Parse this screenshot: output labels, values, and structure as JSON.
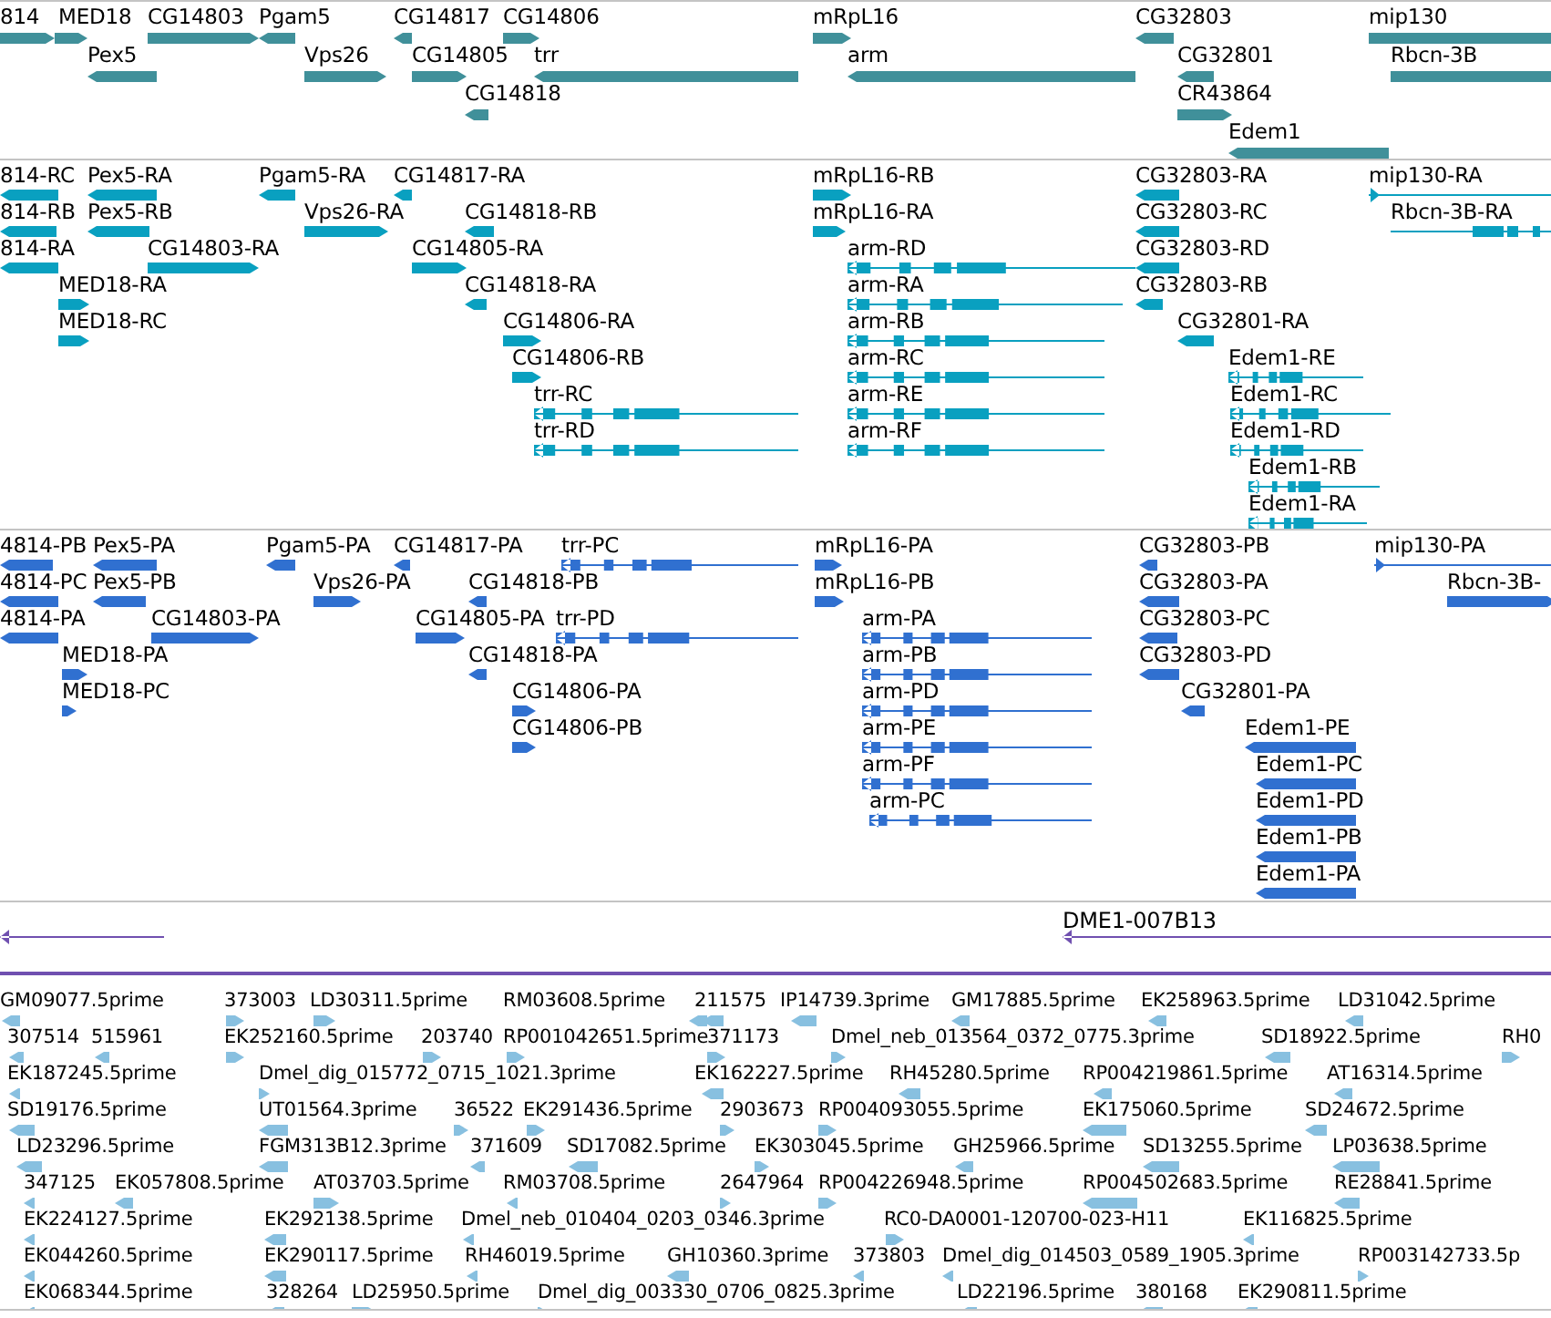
{
  "tracks": [
    {
      "kind": "gene",
      "features": [
        {
          "label": "814",
          "reverse": false
        },
        {
          "label": "MED18",
          "reverse": false
        },
        {
          "label": "CG14803",
          "reverse": false
        },
        {
          "label": "Pgam5",
          "reverse": true
        },
        {
          "label": "CG14817",
          "reverse": true
        },
        {
          "label": "CG14806",
          "reverse": false
        },
        {
          "label": "mRpL16",
          "reverse": false
        },
        {
          "label": "CG32803",
          "reverse": true
        },
        {
          "label": "mip130",
          "reverse": false
        },
        {
          "label": "Pex5",
          "reverse": true
        },
        {
          "label": "Vps26",
          "reverse": false
        },
        {
          "label": "CG14805",
          "reverse": false
        },
        {
          "label": "trr",
          "reverse": true
        },
        {
          "label": "arm",
          "reverse": true
        },
        {
          "label": "CG32801",
          "reverse": true
        },
        {
          "label": "Rbcn-3B",
          "reverse": false
        },
        {
          "label": "CG14818",
          "reverse": true
        },
        {
          "label": "CR43864",
          "reverse": false
        },
        {
          "label": "Edem1",
          "reverse": true
        }
      ]
    },
    {
      "kind": "transcript",
      "features": [
        {
          "label": "814-RC",
          "reverse": true
        },
        {
          "label": "Pex5-RA",
          "reverse": true
        },
        {
          "label": "Pgam5-RA",
          "reverse": true
        },
        {
          "label": "CG14817-RA",
          "reverse": true
        },
        {
          "label": "mRpL16-RB",
          "reverse": false
        },
        {
          "label": "CG32803-RA",
          "reverse": true
        },
        {
          "label": "mip130-RA",
          "reverse": false,
          "kind": "line"
        },
        {
          "label": "814-RB",
          "reverse": true
        },
        {
          "label": "Pex5-RB",
          "reverse": true
        },
        {
          "label": "Vps26-RA",
          "reverse": false
        },
        {
          "label": "CG14818-RB",
          "reverse": true
        },
        {
          "label": "mRpL16-RA",
          "reverse": false
        },
        {
          "label": "CG32803-RC",
          "reverse": true
        },
        {
          "label": "Rbcn-3B-RA",
          "reverse": false,
          "kind": "spliced"
        },
        {
          "label": "814-RA",
          "reverse": true
        },
        {
          "label": "CG14803-RA",
          "reverse": false
        },
        {
          "label": "CG14805-RA",
          "reverse": false
        },
        {
          "label": "arm-RD",
          "reverse": true,
          "kind": "spliced"
        },
        {
          "label": "CG32803-RD",
          "reverse": true
        },
        {
          "label": "MED18-RA",
          "reverse": false
        },
        {
          "label": "CG14818-RA",
          "reverse": true
        },
        {
          "label": "arm-RA",
          "reverse": true,
          "kind": "spliced"
        },
        {
          "label": "CG32803-RB",
          "reverse": true
        },
        {
          "label": "MED18-RC",
          "reverse": false
        },
        {
          "label": "CG14806-RA",
          "reverse": false
        },
        {
          "label": "arm-RB",
          "reverse": true,
          "kind": "spliced"
        },
        {
          "label": "CG32801-RA",
          "reverse": true
        },
        {
          "label": "CG14806-RB",
          "reverse": false
        },
        {
          "label": "arm-RC",
          "reverse": true,
          "kind": "spliced"
        },
        {
          "label": "Edem1-RE",
          "reverse": true,
          "kind": "spliced"
        },
        {
          "label": "trr-RC",
          "reverse": true,
          "kind": "spliced"
        },
        {
          "label": "arm-RE",
          "reverse": true,
          "kind": "spliced"
        },
        {
          "label": "Edem1-RC",
          "reverse": true,
          "kind": "spliced"
        },
        {
          "label": "trr-RD",
          "reverse": true,
          "kind": "spliced"
        },
        {
          "label": "arm-RF",
          "reverse": true,
          "kind": "spliced"
        },
        {
          "label": "Edem1-RD",
          "reverse": true,
          "kind": "spliced"
        },
        {
          "label": "Edem1-RB",
          "reverse": true,
          "kind": "spliced"
        },
        {
          "label": "Edem1-RA",
          "reverse": true,
          "kind": "spliced"
        }
      ]
    },
    {
      "kind": "protein",
      "features": [
        {
          "label": "4814-PB",
          "reverse": true
        },
        {
          "label": "Pex5-PA",
          "reverse": true
        },
        {
          "label": "Pgam5-PA",
          "reverse": true
        },
        {
          "label": "CG14817-PA",
          "reverse": true
        },
        {
          "label": "trr-PC",
          "reverse": true,
          "kind": "spliced"
        },
        {
          "label": "mRpL16-PA",
          "reverse": false
        },
        {
          "label": "CG32803-PB",
          "reverse": true
        },
        {
          "label": "mip130-PA",
          "reverse": false,
          "kind": "line"
        },
        {
          "label": "4814-PC",
          "reverse": true
        },
        {
          "label": "Pex5-PB",
          "reverse": true
        },
        {
          "label": "Vps26-PA",
          "reverse": false
        },
        {
          "label": "CG14818-PB",
          "reverse": true
        },
        {
          "label": "mRpL16-PB",
          "reverse": false
        },
        {
          "label": "CG32803-PA",
          "reverse": true
        },
        {
          "label": "Rbcn-3B-",
          "reverse": false
        },
        {
          "label": "4814-PA",
          "reverse": true
        },
        {
          "label": "CG14803-PA",
          "reverse": false
        },
        {
          "label": "CG14805-PA",
          "reverse": false
        },
        {
          "label": "trr-PD",
          "reverse": true,
          "kind": "spliced"
        },
        {
          "label": "arm-PA",
          "reverse": true,
          "kind": "spliced"
        },
        {
          "label": "CG32803-PC",
          "reverse": true
        },
        {
          "label": "MED18-PA",
          "reverse": false
        },
        {
          "label": "CG14818-PA",
          "reverse": true
        },
        {
          "label": "arm-PB",
          "reverse": true,
          "kind": "spliced"
        },
        {
          "label": "CG32803-PD",
          "reverse": true
        },
        {
          "label": "MED18-PC",
          "reverse": false
        },
        {
          "label": "CG14806-PA",
          "reverse": false
        },
        {
          "label": "arm-PD",
          "reverse": true,
          "kind": "spliced"
        },
        {
          "label": "CG32801-PA",
          "reverse": true
        },
        {
          "label": "CG14806-PB",
          "reverse": false
        },
        {
          "label": "arm-PE",
          "reverse": true,
          "kind": "spliced"
        },
        {
          "label": "Edem1-PE",
          "reverse": true
        },
        {
          "label": "arm-PF",
          "reverse": true,
          "kind": "spliced"
        },
        {
          "label": "Edem1-PC",
          "reverse": true
        },
        {
          "label": "arm-PC",
          "reverse": true,
          "kind": "spliced"
        },
        {
          "label": "Edem1-PD",
          "reverse": true
        },
        {
          "label": "Edem1-PB",
          "reverse": true
        },
        {
          "label": "Edem1-PA",
          "reverse": true
        }
      ]
    },
    {
      "kind": "clone",
      "features": [
        {
          "reverse": true,
          "kind": "line"
        },
        {
          "label": "DME1-007B13",
          "reverse": true,
          "kind": "line"
        }
      ]
    },
    {
      "kind": "est",
      "features": [
        {
          "label": "GM09077.5prime",
          "reverse": true
        },
        {
          "label": "373003",
          "reverse": false
        },
        {
          "label": "LD30311.5prime",
          "reverse": false
        },
        {
          "label": "RM03608.5prime",
          "reverse": true
        },
        {
          "label": "211575",
          "reverse": true
        },
        {
          "label": "IP14739.3prime",
          "reverse": true
        },
        {
          "label": "GM17885.5prime",
          "reverse": true
        },
        {
          "label": "EK258963.5prime",
          "reverse": true
        },
        {
          "label": "LD31042.5prime",
          "reverse": true
        },
        {
          "label": "307514",
          "reverse": true
        },
        {
          "label": "515961",
          "reverse": true
        },
        {
          "label": "EK252160.5prime",
          "reverse": false
        },
        {
          "label": "203740",
          "reverse": false
        },
        {
          "label": "RP001042651.5prime",
          "reverse": false
        },
        {
          "label": "371173",
          "reverse": false
        },
        {
          "label": "Dmel_neb_013564_0372_0775.3prime",
          "reverse": false
        },
        {
          "label": "SD18922.5prime",
          "reverse": true
        },
        {
          "label": "RH0",
          "reverse": false
        },
        {
          "label": "EK187245.5prime",
          "reverse": true
        },
        {
          "label": "Dmel_dig_015772_0715_1021.3prime",
          "reverse": false
        },
        {
          "label": "EK162227.5prime",
          "reverse": true
        },
        {
          "label": "RH45280.5prime",
          "reverse": true
        },
        {
          "label": "RP004219861.5prime",
          "reverse": true
        },
        {
          "label": "AT16314.5prime",
          "reverse": true
        },
        {
          "label": "SD19176.5prime",
          "reverse": true
        },
        {
          "label": "UT01564.3prime",
          "reverse": true
        },
        {
          "label": "36522",
          "reverse": false
        },
        {
          "label": "EK291436.5prime",
          "reverse": false
        },
        {
          "label": "2903673",
          "reverse": false
        },
        {
          "label": "RP004093055.5prime",
          "reverse": false
        },
        {
          "label": "EK175060.5prime",
          "reverse": true
        },
        {
          "label": "SD24672.5prime",
          "reverse": true
        },
        {
          "label": "LD23296.5prime",
          "reverse": true
        },
        {
          "label": "FGM313B12.3prime",
          "reverse": true
        },
        {
          "label": "371609",
          "reverse": true
        },
        {
          "label": "SD17082.5prime",
          "reverse": true
        },
        {
          "label": "EK303045.5prime",
          "reverse": false
        },
        {
          "label": "GH25966.5prime",
          "reverse": true
        },
        {
          "label": "SD13255.5prime",
          "reverse": true
        },
        {
          "label": "LP03638.5prime",
          "reverse": true
        },
        {
          "label": "347125",
          "reverse": true
        },
        {
          "label": "EK057808.5prime",
          "reverse": true
        },
        {
          "label": "AT03703.5prime",
          "reverse": false
        },
        {
          "label": "RM03708.5prime",
          "reverse": true
        },
        {
          "label": "2647964",
          "reverse": false
        },
        {
          "label": "RP004226948.5prime",
          "reverse": false
        },
        {
          "label": "RP004502683.5prime",
          "reverse": true
        },
        {
          "label": "RE28841.5prime",
          "reverse": true
        },
        {
          "label": "EK224127.5prime",
          "reverse": true
        },
        {
          "label": "EK292138.5prime",
          "reverse": true
        },
        {
          "label": "Dmel_neb_010404_0203_0346.3prime",
          "reverse": true
        },
        {
          "label": "RC0-DA0001-120700-023-H11",
          "reverse": false
        },
        {
          "label": "EK116825.5prime",
          "reverse": true
        },
        {
          "label": "EK044260.5prime",
          "reverse": true
        },
        {
          "label": "EK290117.5prime",
          "reverse": true
        },
        {
          "label": "RH46019.5prime",
          "reverse": true
        },
        {
          "label": "GH10360.3prime",
          "reverse": true
        },
        {
          "label": "373803",
          "reverse": true
        },
        {
          "label": "Dmel_dig_014503_0589_1905.3prime",
          "reverse": true
        },
        {
          "label": "RP003142733.5p",
          "reverse": false
        },
        {
          "label": "EK068344.5prime",
          "reverse": true
        },
        {
          "label": "328264",
          "reverse": true
        },
        {
          "label": "LD25950.5prime",
          "reverse": false
        },
        {
          "label": "Dmel_dig_003330_0706_0825.3prime",
          "reverse": false
        },
        {
          "label": "LD22196.5prime",
          "reverse": true
        },
        {
          "label": "380168",
          "reverse": true
        },
        {
          "label": "EK290811.5prime",
          "reverse": true
        }
      ]
    }
  ]
}
